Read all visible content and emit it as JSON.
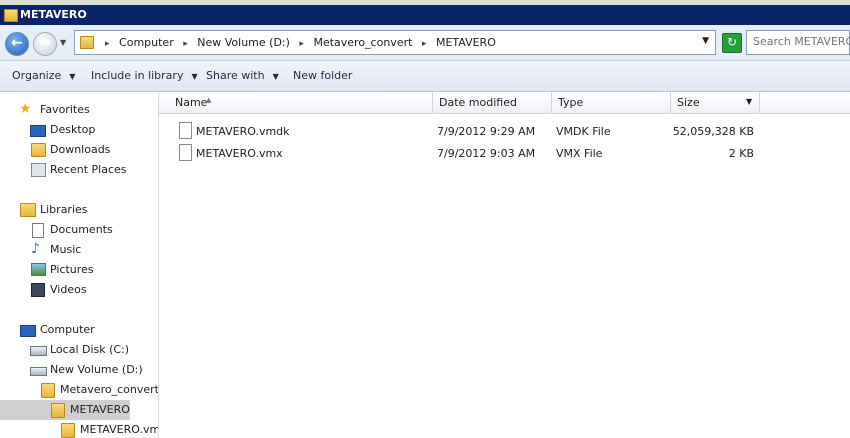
{
  "window": {
    "title": "METAVERO"
  },
  "nav": {
    "back_icon": "arrow-left-icon",
    "forward_icon": "arrow-right-icon"
  },
  "address": {
    "crumbs": [
      "Computer",
      "New Volume (D:)",
      "Metavero_convert",
      "METAVERO"
    ],
    "separator": "▸"
  },
  "search": {
    "placeholder": "Search METAVERO"
  },
  "toolbar": {
    "organize": "Organize",
    "include": "Include in library",
    "share": "Share with",
    "newfolder": "New folder"
  },
  "sidebar": {
    "favorites": "Favorites",
    "desktop": "Desktop",
    "downloads": "Downloads",
    "recent": "Recent Places",
    "libraries": "Libraries",
    "documents": "Documents",
    "music": "Music",
    "pictures": "Pictures",
    "videos": "Videos",
    "computer": "Computer",
    "localdisk": "Local Disk (C:)",
    "newvolume": "New Volume (D:)",
    "metavero_convert": "Metavero_convert",
    "metavero": "METAVERO",
    "metavero_vmdk": "METAVERO.vmdk"
  },
  "columns": {
    "name": "Name",
    "date": "Date modified",
    "type": "Type",
    "size": "Size"
  },
  "files": [
    {
      "name": "METAVERO.vmdk",
      "date": "7/9/2012 9:29 AM",
      "type": "VMDK File",
      "size": "52,059,328 KB"
    },
    {
      "name": "METAVERO.vmx",
      "date": "7/9/2012 9:03 AM",
      "type": "VMX File",
      "size": "2 KB"
    }
  ],
  "colors": {
    "titlebar": "#0a246a",
    "selection": "#cfcfcf"
  }
}
